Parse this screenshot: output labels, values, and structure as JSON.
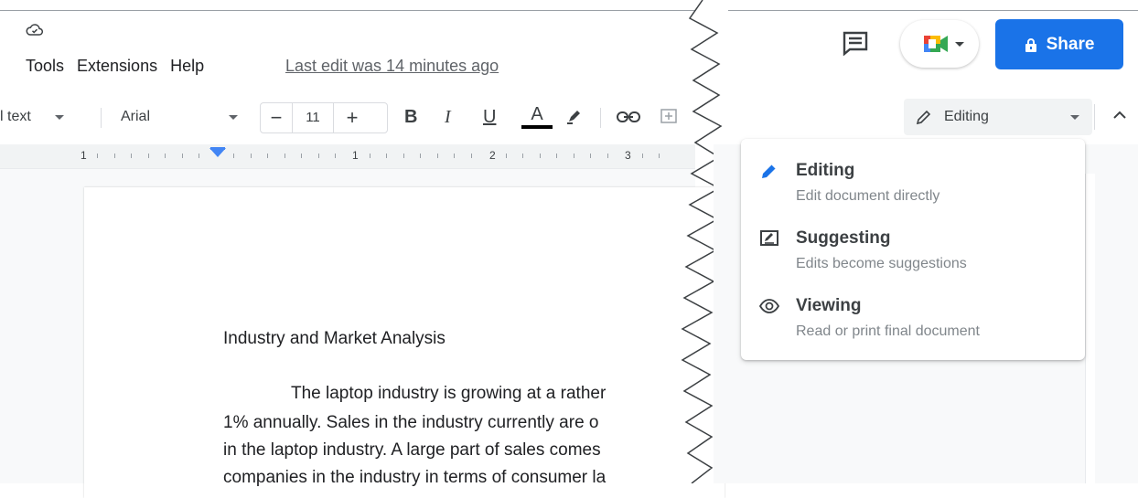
{
  "menu": {
    "items": [
      "Tools",
      "Extensions",
      "Help"
    ],
    "last_edit": "Last edit was 14 minutes ago"
  },
  "toolbar": {
    "style_text": "l text",
    "font": "Arial",
    "font_size": "11",
    "minus": "−",
    "plus": "+"
  },
  "ruler": {
    "labels": [
      "1",
      "1",
      "2",
      "3"
    ]
  },
  "document": {
    "title": "Industry and Market Analysis",
    "lines": [
      "The laptop industry is growing at a rather",
      "1% annually.  Sales in the industry currently are o",
      "in the laptop industry. A large part of sales comes",
      "companies in the industry in terms of consumer la"
    ]
  },
  "header": {
    "share_label": "Share",
    "mode_label": "Editing"
  },
  "mode_menu": {
    "options": [
      {
        "title": "Editing",
        "desc": "Edit document directly",
        "icon": "pencil-icon"
      },
      {
        "title": "Suggesting",
        "desc": "Edits become suggestions",
        "icon": "suggest-icon"
      },
      {
        "title": "Viewing",
        "desc": "Read or print final document",
        "icon": "eye-icon"
      }
    ]
  },
  "colors": {
    "accent": "#1a73e8",
    "text_color_bar": "#000000",
    "ruler_marker": "#4285f4"
  }
}
